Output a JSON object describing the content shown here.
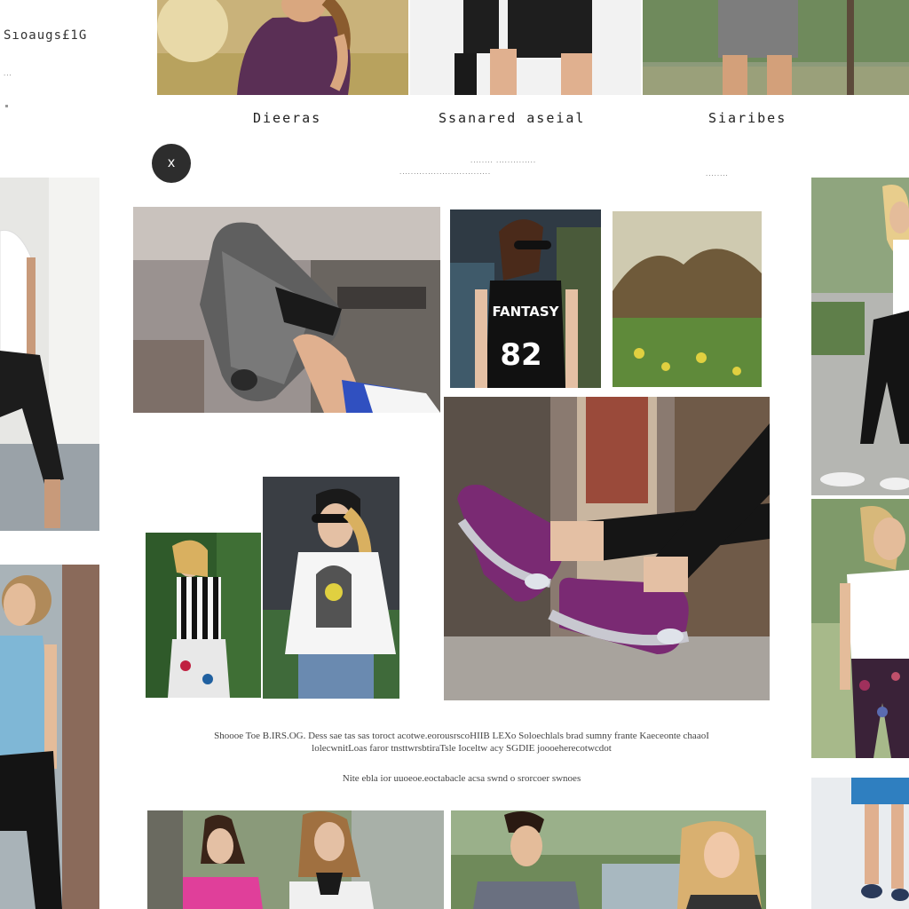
{
  "brand": {
    "name": "Sıoaugs£1G",
    "tagline": "..."
  },
  "nav": {
    "designs": "Dieeras",
    "featured": "Ssanared aseial",
    "stories": "Siaribes"
  },
  "featured_sub": {
    "line1": "........ ..............",
    "line2": "................................",
    "line3": "........"
  },
  "close_button": {
    "icon": "x"
  },
  "description": {
    "paragraph": "Shoooe Toe B.IRS.OG. Dess sae tas sas toroct acotwe.eorousrscoHIIB LEXo Soloechlals brad sumny frante Kaeceonte chaaoI lolecwnitLoas faror tnsttwrsbtiraTsle Ioceltw acy SGDIE joooeherecotwcdot",
    "footer": "Nite ebla ior uuoeoe.eoctabacle acsa swnd o srorcoer swnoes"
  },
  "colors": {
    "accent": "#2d2d2d",
    "shoe_purple": "#7a2a73",
    "shoe_grey": "#5f5f5f"
  },
  "icons": {
    "close": "close-icon"
  }
}
